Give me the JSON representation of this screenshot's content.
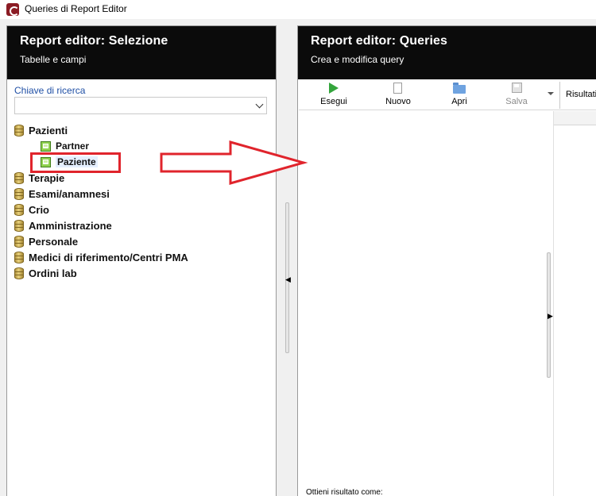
{
  "window": {
    "title": "Queries di Report Editor"
  },
  "left_panel": {
    "title": "Report editor: Selezione",
    "subtitle": "Tabelle e campi",
    "search_label": "Chiave di ricerca",
    "search_value": "",
    "tree": [
      {
        "label": "Pazienti",
        "type": "database",
        "expanded": true
      },
      {
        "label": "Partner",
        "type": "table"
      },
      {
        "label": "Paziente",
        "type": "table",
        "selected": true
      },
      {
        "label": "Terapie",
        "type": "database"
      },
      {
        "label": "Esami/anamnesi",
        "type": "database"
      },
      {
        "label": "Crio",
        "type": "database"
      },
      {
        "label": "Amministrazione",
        "type": "database"
      },
      {
        "label": "Personale",
        "type": "database"
      },
      {
        "label": "Medici di riferimento/Centri PMA",
        "type": "database"
      },
      {
        "label": "Ordini lab",
        "type": "database"
      }
    ]
  },
  "right_panel": {
    "title": "Report editor: Queries",
    "subtitle": "Crea e modifica query",
    "toolbar": [
      {
        "label": "Esegui",
        "icon": "play-icon",
        "enabled": true
      },
      {
        "label": "Nuovo",
        "icon": "new-document-icon",
        "enabled": true
      },
      {
        "label": "Apri",
        "icon": "open-folder-icon",
        "enabled": true
      },
      {
        "label": "Salva",
        "icon": "save-icon",
        "enabled": false
      }
    ],
    "results_tab": "Risultati",
    "result_as_label": "Ottieni risultato come:"
  },
  "colors": {
    "header_bg": "#0b0b0b",
    "accent_link": "#1f4fa5",
    "annotation_red": "#e0242c",
    "selection_bg": "#e5efff",
    "run_green": "#34a53c"
  }
}
